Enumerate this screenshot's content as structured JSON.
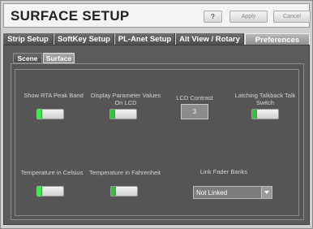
{
  "window": {
    "title": "SURFACE SETUP",
    "buttons": {
      "help": "?",
      "apply": "Apply",
      "cancel": "Cancel"
    }
  },
  "tabs": [
    {
      "label": "Strip Setup",
      "active": false
    },
    {
      "label": "SoftKey Setup",
      "active": false
    },
    {
      "label": "PL-Anet Setup",
      "active": false
    },
    {
      "label": "Alt View / Rotary",
      "active": false
    },
    {
      "label": "Preferences",
      "active": true
    }
  ],
  "subtabs": [
    {
      "label": "Scene",
      "active": false
    },
    {
      "label": "Surface",
      "active": true
    }
  ],
  "settings": {
    "rta_peak_band": {
      "label": "Show RTA Peak Band",
      "state": "on"
    },
    "display_param_lcd": {
      "label": "Display Parameter Values On LCD",
      "state": "off"
    },
    "lcd_contrast": {
      "label": "LCD Contrast",
      "value": "3"
    },
    "latching_talkback": {
      "label": "Latching Talkback Talk Switch",
      "state": "off"
    },
    "temp_celsius": {
      "label": "Temperature in Celsius",
      "state": "on"
    },
    "temp_fahrenheit": {
      "label": "Temperature in Fahrenheit",
      "state": "off"
    },
    "link_fader_banks": {
      "label": "Link Fader Banks",
      "value": "Not Linked"
    }
  },
  "colors": {
    "led_on": "#3ee846",
    "led_off": "#34c23c",
    "panel": "#555555"
  }
}
